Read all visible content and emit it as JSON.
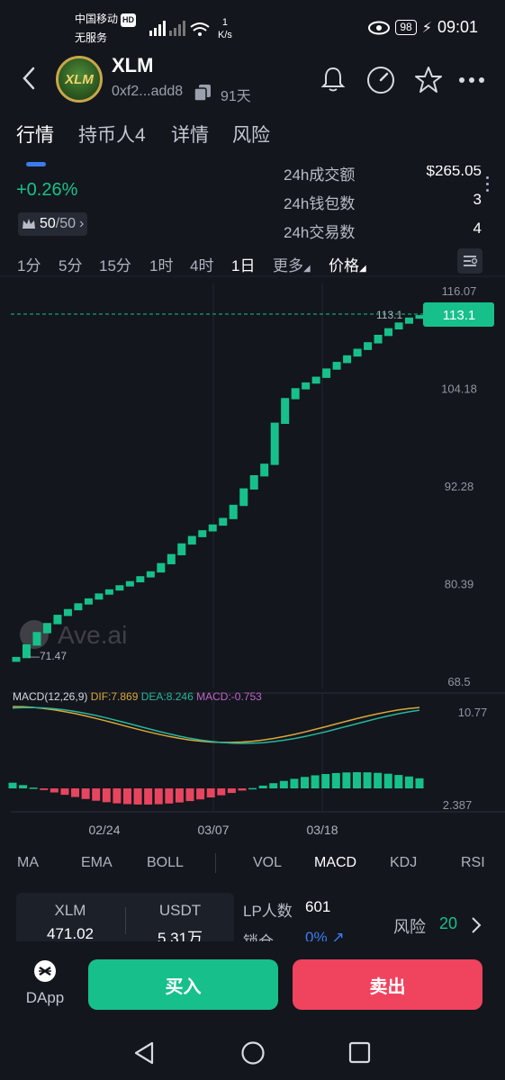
{
  "status_bar": {
    "carrier": "中国移动",
    "hd": "HD",
    "service": "无服务",
    "speed_value": "1",
    "speed_unit": "K/s",
    "battery": "98",
    "time": "09:01"
  },
  "header": {
    "logo_text": "XLM",
    "token_name": "XLM",
    "address": "0xf2...add8",
    "age": "91天"
  },
  "tabs": [
    "行情",
    "持币人4",
    "详情",
    "风险"
  ],
  "stats": {
    "change": "+0.26%",
    "crown_value": "50",
    "crown_total": "/50",
    "rows": [
      {
        "label": "24h成交额",
        "value": "$265.05"
      },
      {
        "label": "24h钱包数",
        "value": "3"
      },
      {
        "label": "24h交易数",
        "value": "4"
      }
    ]
  },
  "timeframes": [
    "1分",
    "5分",
    "15分",
    "1时",
    "4时",
    "1日",
    "更多",
    "价格"
  ],
  "chart": {
    "watermark": "Ave.ai",
    "price_tag": "113.1",
    "last_price_label": "113.1",
    "low_label": "71.47",
    "y_ticks": [
      "116.07",
      "104.18",
      "92.28",
      "80.39",
      "68.5"
    ],
    "macd_ticks": [
      "10.77",
      "2.387"
    ],
    "x_ticks": [
      "02/24",
      "03/07",
      "03/18"
    ],
    "macd_header": {
      "name": "MACD(12,26,9)",
      "dif": "DIF:7.869",
      "dea": "DEA:8.246",
      "macd": "MACD:-0.753"
    },
    "colors": {
      "up": "#17c08a",
      "down": "#e7455f",
      "dif": "#d9a83a",
      "dea": "#28b69b",
      "macd": "#c264c8"
    }
  },
  "chart_data": {
    "type": "candlestick",
    "ylim": [
      68.5,
      116.07
    ],
    "candles_close": [
      71.47,
      73.0,
      74.5,
      75.6,
      76.6,
      77.3,
      78.0,
      78.6,
      79.2,
      79.7,
      80.2,
      80.7,
      81.3,
      81.9,
      82.9,
      84.0,
      85.3,
      86.2,
      86.9,
      87.6,
      88.4,
      90.0,
      92.0,
      93.6,
      95.0,
      100.0,
      103.0,
      104.2,
      104.9,
      105.6,
      106.6,
      107.4,
      108.2,
      109.0,
      109.8,
      110.7,
      111.5,
      112.2,
      112.8,
      113.1
    ],
    "last_price": 113.1,
    "macd_ylim": [
      2.387,
      10.77
    ]
  },
  "indicators": [
    "MA",
    "EMA",
    "BOLL",
    "VOL",
    "MACD",
    "KDJ",
    "RSI"
  ],
  "bottom": {
    "col1_label": "XLM",
    "col1_value": "471.02",
    "col2_label": "USDT",
    "col2_value": "5.31万",
    "lp_label": "LP人数",
    "lp_value": "601",
    "lock_label": "锁仓",
    "lock_value": "0%",
    "risk_label": "风险",
    "risk_value": "20"
  },
  "actions": {
    "dapp": "DApp",
    "buy": "买入",
    "sell": "卖出"
  }
}
